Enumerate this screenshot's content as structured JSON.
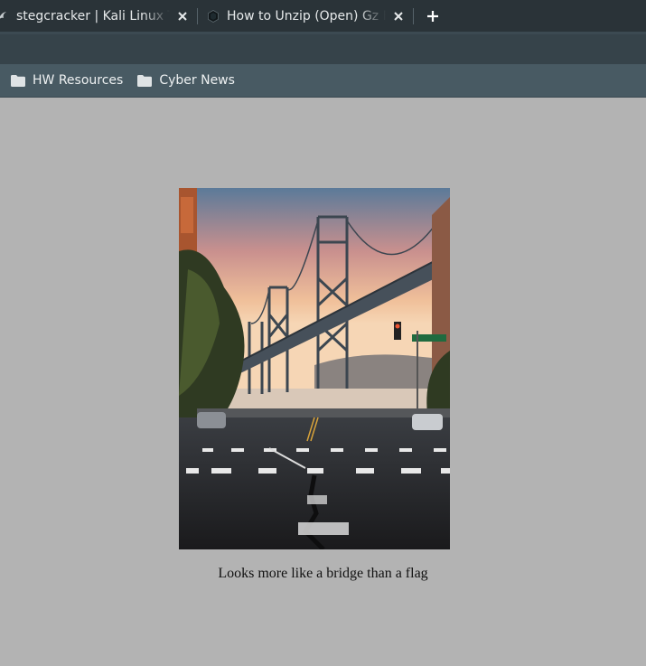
{
  "tabs": [
    {
      "title": "stegcracker | Kali Linux Tools"
    },
    {
      "title": "How to Unzip (Open) Gz Files"
    }
  ],
  "icons": {
    "tab_close": "close-icon",
    "new_tab": "plus-icon",
    "bookmark_folder": "folder-icon"
  },
  "bookmarks": [
    {
      "label": "HW Resources"
    },
    {
      "label": "Cyber News"
    }
  ],
  "page": {
    "caption": "Looks more like a bridge than a flag"
  },
  "colors": {
    "tab_strip": "#2a3338",
    "toolbar": "#36434a",
    "bookmarks_bar": "#485a63",
    "page_background": "#b3b3b3"
  }
}
